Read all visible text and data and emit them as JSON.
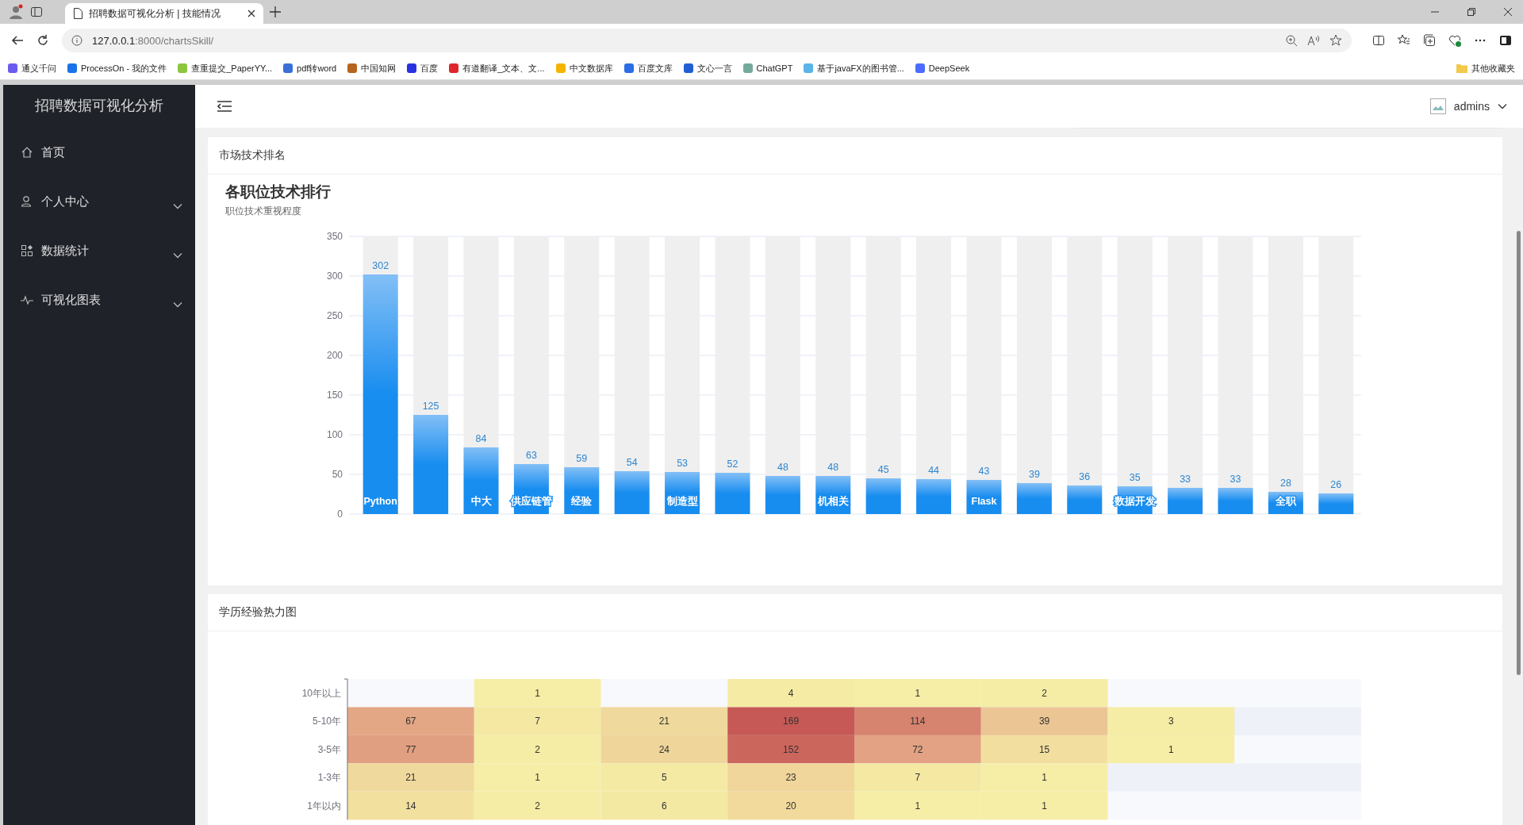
{
  "browser": {
    "tab": {
      "title": "招聘数据可视化分析 | 技能情况",
      "selected": true
    },
    "address": {
      "host": "127.0.0.1",
      "path": ":8000/chartsSkill/"
    },
    "bookmarks": [
      {
        "label": "通义千问",
        "color": "#6b5cf0"
      },
      {
        "label": "ProcessOn - 我的文件",
        "color": "#1a73e8"
      },
      {
        "label": "查重提交_PaperYY...",
        "color": "#8cc63f"
      },
      {
        "label": "pdf转word",
        "color": "#3a6fd8"
      },
      {
        "label": "中国知网",
        "color": "#b5651d"
      },
      {
        "label": "百度",
        "color": "#2932e1"
      },
      {
        "label": "有道翻译_文本、文...",
        "color": "#e0262b"
      },
      {
        "label": "中文数据库",
        "color": "#f5b400"
      },
      {
        "label": "百度文库",
        "color": "#2b6de5"
      },
      {
        "label": "文心一言",
        "color": "#1f5fd1"
      },
      {
        "label": "ChatGPT",
        "color": "#74aa9c"
      },
      {
        "label": "基于javaFX的图书管...",
        "color": "#5ab4e8"
      },
      {
        "label": "DeepSeek",
        "color": "#4d6bfe"
      }
    ],
    "other_bookmarks": "其他收藏夹"
  },
  "sidebar": {
    "title": "招聘数据可视化分析",
    "items": [
      {
        "label": "首页",
        "kind": "home"
      },
      {
        "label": "个人中心",
        "kind": "user",
        "expanded": false
      },
      {
        "label": "数据统计",
        "kind": "grid",
        "expanded": false
      },
      {
        "label": "可视化图表",
        "kind": "pulse",
        "expanded": false
      }
    ]
  },
  "header": {
    "user": "admins"
  },
  "skill_card": {
    "title": "市场技术排名",
    "chart_data": {
      "type": "bar",
      "title": "各职位技术排行",
      "subtitle": "职位技术重视程度",
      "ylim": [
        0,
        350
      ],
      "yticks": [
        0,
        50,
        100,
        150,
        200,
        250,
        300,
        350
      ],
      "data_labels": true,
      "grid": true,
      "categories": [
        "Python",
        null,
        "中大",
        "供应链管",
        "经验",
        null,
        "制造型",
        null,
        null,
        "机相关",
        null,
        null,
        "Flask",
        null,
        null,
        "数据开发",
        null,
        null,
        "全职",
        null
      ],
      "values": [
        302,
        125,
        84,
        63,
        59,
        54,
        53,
        52,
        48,
        48,
        45,
        44,
        43,
        39,
        36,
        35,
        33,
        33,
        28,
        26
      ]
    }
  },
  "heatmap_card": {
    "title": "学历经验热力图",
    "rows": [
      {
        "label": "10年以上",
        "cells": [
          null,
          "1",
          null,
          "4",
          "1",
          "2",
          null,
          null
        ]
      },
      {
        "label": "5-10年",
        "cells": [
          "67",
          "7",
          "21",
          "169",
          "114",
          "39",
          "3",
          null
        ]
      },
      {
        "label": "3-5年",
        "cells": [
          "77",
          "2",
          "24",
          "152",
          "72",
          "15",
          "1",
          null
        ]
      },
      {
        "label": "1-3年",
        "cells": [
          "21",
          "1",
          "5",
          "23",
          "7",
          "1",
          null,
          null
        ]
      },
      {
        "label": "1年以内",
        "cells": [
          "14",
          "2",
          "6",
          "20",
          "1",
          "1",
          null,
          null
        ]
      }
    ]
  }
}
